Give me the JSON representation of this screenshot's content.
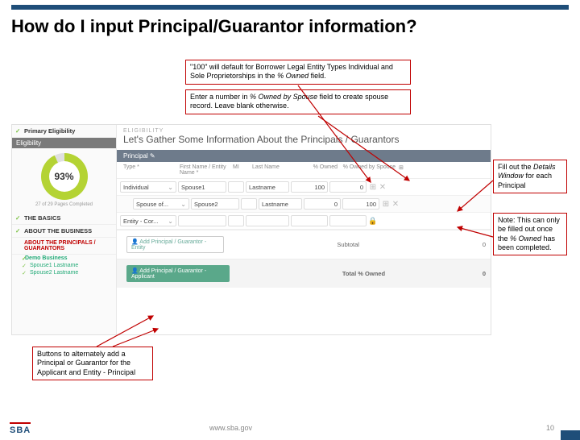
{
  "slide": {
    "title": "How do I input Principal/Guarantor information?",
    "footer_url": "www.sba.gov",
    "page_num": "10",
    "logo": "SBA"
  },
  "callouts": {
    "top1a": "\"100\" will default for Borrower Legal Entity Types Individual and Sole Proprietorships in the ",
    "top1b": "% Owned",
    "top1c": " field.",
    "top2a": "Enter a number in ",
    "top2b": "% Owned by Spouse",
    "top2c": " field to create spouse record.  Leave blank otherwise.",
    "right1a": "Fill out the ",
    "right1b": "Details Window",
    "right1c": " for each Principal",
    "right2a": "Note: This can only be filled out once the ",
    "right2b": "% Owned",
    "right2c": " has been completed.",
    "bl": "Buttons to alternately add a Principal or Guarantor for the Applicant and Entity - Principal"
  },
  "app": {
    "sb_primary": "Primary Eligibility",
    "sb_elig": "Eligibility",
    "donut_pct": "93%",
    "donut_cap": "27 of 29 Pages Completed",
    "sb_basics": "THE BASICS",
    "sb_about": "ABOUT THE BUSINESS",
    "sb_principals": "ABOUT THE PRINCIPALS / GUARANTORS",
    "sb_demo": "Demo Business",
    "sb_sp1": "Spouse1 Lastname",
    "sb_sp2": "Spouse2 Lastname",
    "elig_lbl": "ELIGIBILITY",
    "main_h": "Let's Gather Some Information About the Principals / Guarantors",
    "prin_bar": "Principal",
    "hdr": {
      "type": "Type *",
      "first": "First Name / Entity Name *",
      "mi": "MI",
      "last": "Last Name",
      "pct": "% Owned",
      "spouse": "% Owned by Spouse"
    },
    "rows": [
      {
        "type": "Individual",
        "first": "Spouse1",
        "mi": "",
        "last": "Lastname",
        "pct": "100",
        "spouse": "0"
      },
      {
        "type": "Spouse of...",
        "first": "Spouse2",
        "mi": "",
        "last": "Lastname",
        "pct": "0",
        "spouse": "100"
      },
      {
        "type": "Entity - Cor...",
        "first": "",
        "mi": "",
        "last": "",
        "pct": "",
        "spouse": ""
      }
    ],
    "btn_add1": "Add Principal / Guarantor - Entity",
    "btn_add2": "Add Principal / Guarantor - Applicant",
    "subtotal_lbl": "Subtotal",
    "subtotal_val": "0",
    "total_lbl": "Total % Owned",
    "total_val": "0"
  }
}
